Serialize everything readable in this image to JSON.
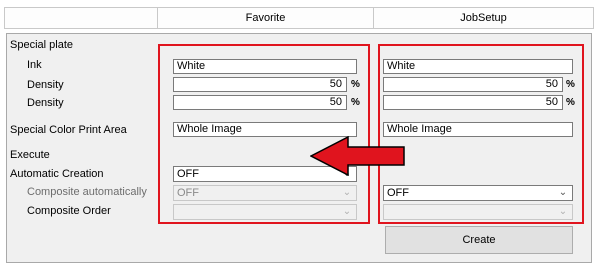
{
  "header": {
    "favorite_label": "Favorite",
    "jobsetup_label": "JobSetup"
  },
  "labels": {
    "special_plate": "Special plate",
    "ink": "Ink",
    "density_1": "Density",
    "density_2": "Density",
    "special_color_print_area": "Special Color Print Area",
    "execute": "Execute",
    "automatic_creation": "Automatic Creation",
    "composite_automatically": "Composite automatically",
    "composite_order": "Composite Order"
  },
  "favorite": {
    "ink": "White",
    "density_1": "50",
    "density_2": "50",
    "density_unit": "%",
    "print_area": "Whole Image",
    "automatic_creation": "OFF",
    "composite_automatically": "OFF",
    "composite_order": ""
  },
  "jobsetup": {
    "ink": "White",
    "density_1": "50",
    "density_2": "50",
    "density_unit": "%",
    "print_area": "Whole Image",
    "composite_automatically": "OFF",
    "composite_order": "",
    "create_button": "Create"
  },
  "icons": {
    "dropdown": "chevron-down-icon",
    "arrow": "left-arrow-icon"
  },
  "colors": {
    "highlight": "#e0141e",
    "panel_bg": "#f0f0f0"
  }
}
